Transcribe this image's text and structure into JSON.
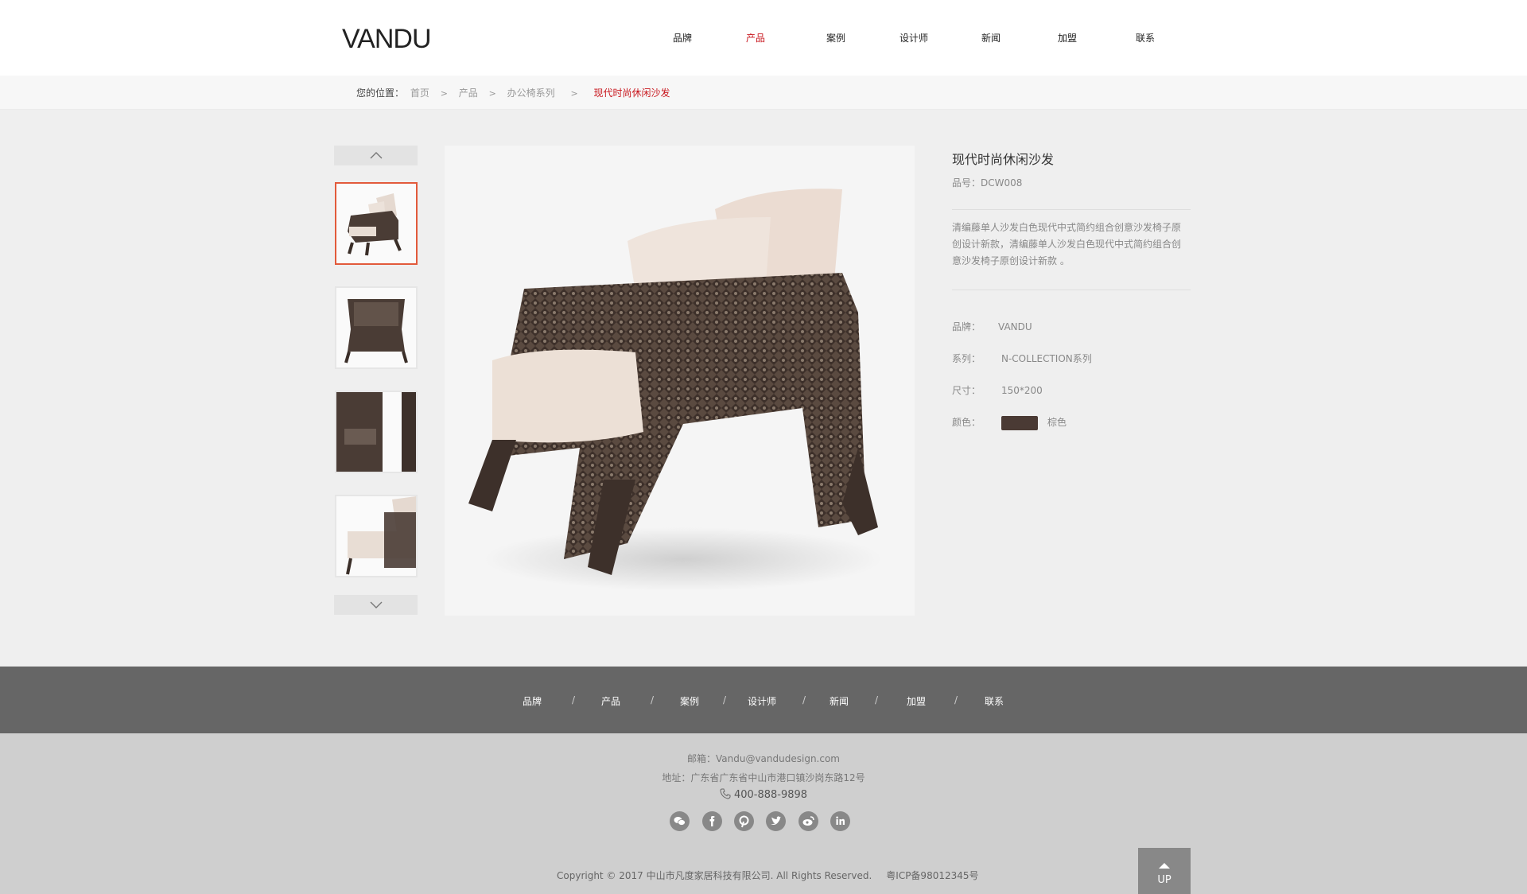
{
  "brand": {
    "logo": "VANDU"
  },
  "nav": {
    "items": [
      "品牌",
      "产品",
      "案例",
      "设计师",
      "新闻",
      "加盟",
      "联系"
    ],
    "active": "产品"
  },
  "breadcrumb": {
    "lead": "您的位置：",
    "items": [
      "首页",
      "产品",
      "办公椅系列"
    ],
    "current": "现代时尚休闲沙发"
  },
  "product": {
    "title": "现代时尚休闲沙发",
    "code": "品号：DCW008",
    "description": "清编藤单人沙发白色现代中式简约组合创意沙发椅子原创设计新款，清编藤单人沙发白色现代中式简约组合创意沙发椅子原创设计新款 。",
    "specs": {
      "brand_label": "品牌：",
      "brand_value": "VANDU",
      "series_label": "系列：",
      "series_value": "N-COLLECTION系列",
      "size_label": "尺寸：",
      "size_value": "150*200",
      "color_label": "颜色：",
      "color_value": "棕色",
      "swatch_color": "#4a3a34"
    }
  },
  "footer": {
    "nav": [
      "品牌",
      "产品",
      "案例",
      "设计师",
      "新闻",
      "加盟",
      "联系"
    ],
    "separator": "/",
    "email": "邮箱：Vandu@vandudesign.com",
    "address": "地址：广东省广东省中山市港口镇沙岗东路12号",
    "phone": "400-888-9898",
    "socials": [
      "wechat-icon",
      "facebook-icon",
      "pinterest-icon",
      "twitter-icon",
      "weibo-icon",
      "linkedin-icon"
    ],
    "copyright": "Copyright © 2017 中山市凡度家居科技有限公司. All Rights Reserved.",
    "icp": "粤ICP备98012345号",
    "up_label": "UP"
  },
  "colors": {
    "accent": "#c8161d",
    "thumb_active_border": "#e25a3b"
  }
}
